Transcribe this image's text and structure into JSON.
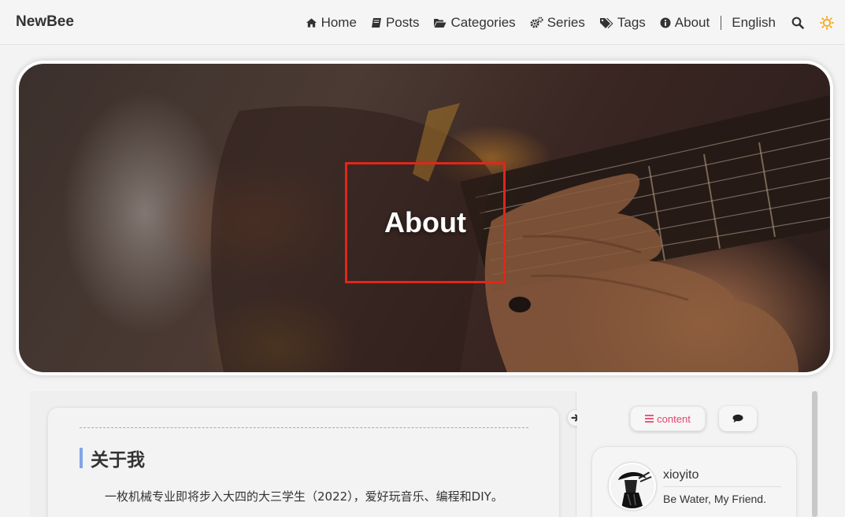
{
  "navbar": {
    "brand": "NewBee",
    "items": [
      {
        "label": "Home",
        "icon": "home-icon"
      },
      {
        "label": "Posts",
        "icon": "book-icon"
      },
      {
        "label": "Categories",
        "icon": "folder-open-icon"
      },
      {
        "label": "Series",
        "icon": "cogs-icon"
      },
      {
        "label": "Tags",
        "icon": "tags-icon"
      },
      {
        "label": "About",
        "icon": "info-circle-icon"
      }
    ],
    "language": "English",
    "search_icon": "search-icon",
    "theme_icon": "sun-icon"
  },
  "hero": {
    "title": "About",
    "highlight_color": "#e0261b"
  },
  "article": {
    "heading": "关于我",
    "paragraph": "一枚机械专业即将步入大四的大三学生（2022），爱好玩音乐、编程和DIY。",
    "heading_bar_color": "#7fa6e6"
  },
  "sidebar": {
    "tabs": {
      "content_label": "content",
      "content_icon": "list-icon",
      "comment_icon": "comment-icon",
      "accent_color": "#e8446b"
    },
    "profile": {
      "name": "xioyito",
      "motto": "Be Water, My Friend."
    }
  }
}
